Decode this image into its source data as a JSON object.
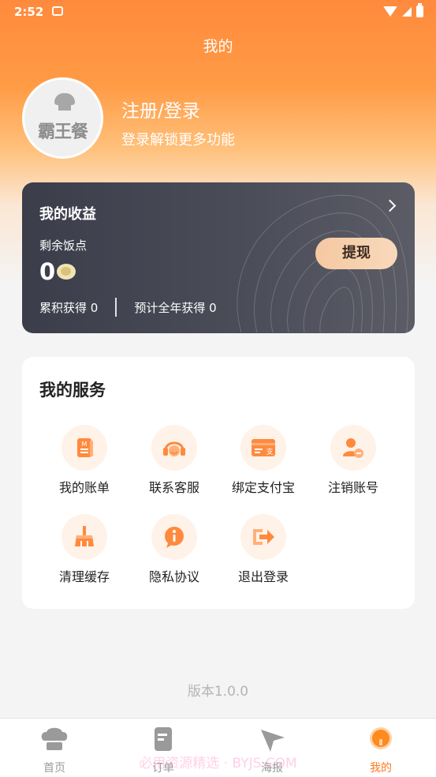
{
  "status_bar": {
    "time": "2:52"
  },
  "header": {
    "title": "我的"
  },
  "profile": {
    "avatar_text": "霸王餐",
    "login_title": "注册/登录",
    "login_subtitle": "登录解锁更多功能"
  },
  "earnings": {
    "title": "我的收益",
    "balance_label": "剩余饭点",
    "balance_value": "0",
    "withdraw_label": "提现",
    "total_label": "累积获得 0",
    "yearly_label": "预计全年获得 0"
  },
  "services": {
    "title": "我的服务",
    "items": [
      {
        "label": "我的账单",
        "icon": "bill-icon"
      },
      {
        "label": "联系客服",
        "icon": "headset-icon"
      },
      {
        "label": "绑定支付宝",
        "icon": "alipay-card-icon"
      },
      {
        "label": "注销账号",
        "icon": "user-remove-icon"
      },
      {
        "label": "清理缓存",
        "icon": "broom-icon"
      },
      {
        "label": "隐私协议",
        "icon": "info-bubble-icon"
      },
      {
        "label": "退出登录",
        "icon": "logout-icon"
      }
    ]
  },
  "version": "版本1.0.0",
  "tabbar": {
    "items": [
      {
        "label": "首页",
        "icon": "chef-hat-icon",
        "active": false
      },
      {
        "label": "订单",
        "icon": "order-doc-icon",
        "active": false
      },
      {
        "label": "海报",
        "icon": "send-arrow-icon",
        "active": false
      },
      {
        "label": "我的",
        "icon": "bulb-icon",
        "active": true
      }
    ]
  },
  "watermark": "必用资源精选 · BYJS.COM",
  "colors": {
    "accent": "#ff7a1e",
    "header_gradient_top": "#ff8a3d",
    "earnings_card": "#3b3d4a",
    "withdraw_button": "#f5c8a1",
    "service_icon_bg": "#fff2e8"
  }
}
